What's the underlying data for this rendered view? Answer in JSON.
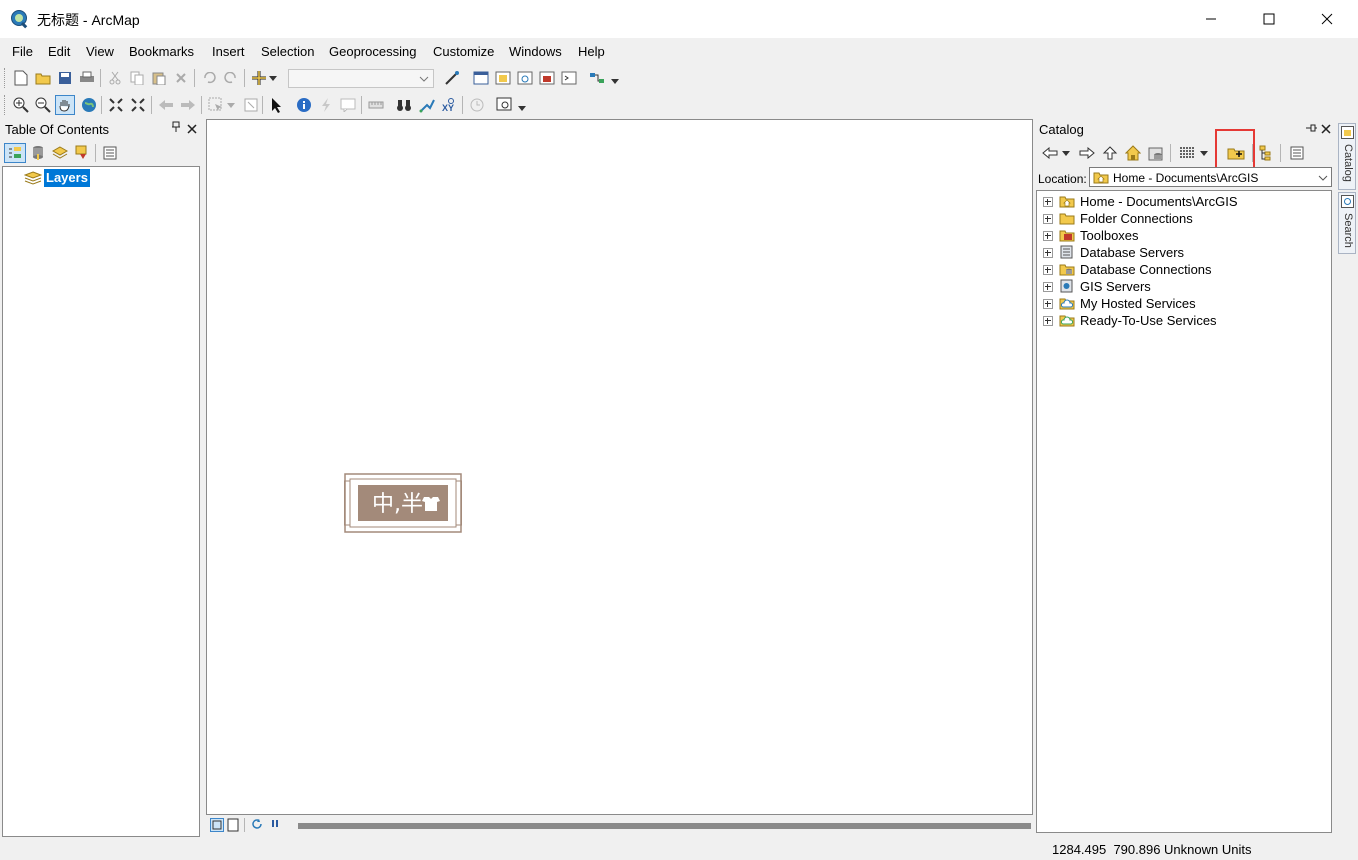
{
  "window": {
    "title": "无标题 - ArcMap",
    "controls": {
      "minimize": "—",
      "maximize": "☐",
      "close": "✕"
    }
  },
  "menu": [
    "File",
    "Edit",
    "View",
    "Bookmarks",
    "Insert",
    "Selection",
    "Geoprocessing",
    "Customize",
    "Windows",
    "Help"
  ],
  "toolbar": {
    "scale_value": ""
  },
  "toc": {
    "title": "Table Of Contents",
    "layers_label": "Layers"
  },
  "catalog": {
    "title": "Catalog",
    "location_label": "Location:",
    "location_value": "Home - Documents\\ArcGIS",
    "items": [
      "Home - Documents\\ArcGIS",
      "Folder Connections",
      "Toolboxes",
      "Database Servers",
      "Database Connections",
      "GIS Servers",
      "My Hosted Services",
      "Ready-To-Use Services"
    ]
  },
  "side_tabs": [
    "Catalog",
    "Search"
  ],
  "watermark": {
    "text": "中,半"
  },
  "status": {
    "coordinates": "1284.495  790.896 Unknown Units"
  },
  "colors": {
    "highlight": "#0078d7",
    "red_box": "#e53935",
    "watermark": "#a38a7a",
    "folder": "#e8b93c"
  }
}
